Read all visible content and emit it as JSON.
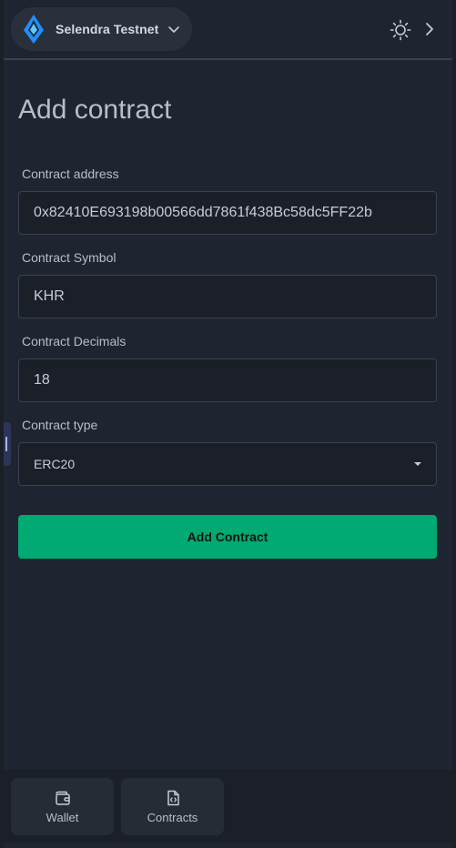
{
  "header": {
    "network_name": "Selendra Testnet",
    "icons": {
      "network_logo": "selendra-logo-icon",
      "network_dropdown": "chevron-down-icon",
      "theme_toggle": "sun-icon",
      "expand": "chevron-right-icon"
    },
    "colors": {
      "logo_primary": "#1e90ff",
      "logo_secondary": "#5fc8ff"
    }
  },
  "main": {
    "title": "Add contract",
    "fields": [
      {
        "label": "Contract address",
        "value": "0x82410E693198b00566dd7861f438Bc58dc5FF22b"
      },
      {
        "label": "Contract Symbol",
        "value": "KHR"
      },
      {
        "label": "Contract Decimals",
        "value": "18"
      },
      {
        "label": "Contract type",
        "value": "ERC20"
      }
    ],
    "submit_label": "Add Contract",
    "colors": {
      "submit_bg": "#00aa72"
    }
  },
  "bottom_nav": {
    "tabs": [
      {
        "label": "Wallet",
        "icon": "wallet-icon"
      },
      {
        "label": "Contracts",
        "icon": "file-code-icon"
      }
    ]
  }
}
